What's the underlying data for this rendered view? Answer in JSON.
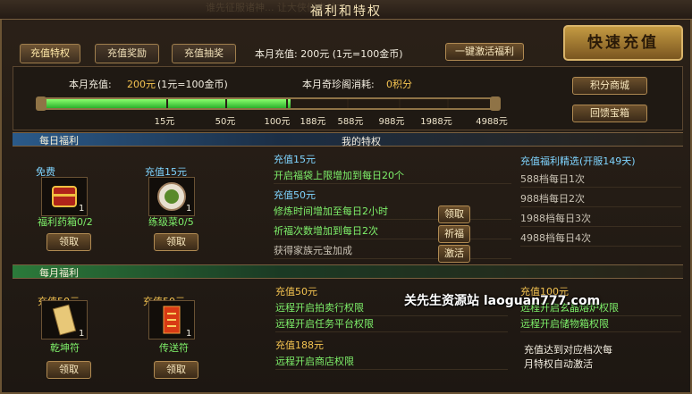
{
  "window": {
    "title": "福利和特权",
    "banner": "谁先征服诸神... 让大侠们去战之!"
  },
  "tabs": [
    {
      "label": "充值特权",
      "active": true
    },
    {
      "label": "充值奖励",
      "active": false
    },
    {
      "label": "充值抽奖",
      "active": false
    }
  ],
  "header": {
    "monthly_recharge": "本月充值: 200元 (1元=100金币)",
    "activate_button": "一键激活福利",
    "quick_recharge": "快速充值"
  },
  "progress": {
    "recharge_label": "本月充值:",
    "recharge_value": "200元",
    "recharge_note": "(1元=100金币)",
    "consume_label": "本月奇珍阁消耗:",
    "consume_value": "0积分",
    "ticks": [
      "15元",
      "50元",
      "100元",
      "188元",
      "588元",
      "988元",
      "1988元",
      "4988元"
    ],
    "filled_fraction": 0.55
  },
  "side_buttons": {
    "shop": "积分商城",
    "treasure": "回馈宝箱"
  },
  "daily": {
    "section_label": "每日福利",
    "privilege_title": "我的特权",
    "items": [
      {
        "tag": "免费",
        "name": "福利药箱0/2",
        "count": "1",
        "claim": "领取",
        "icon": "chest-icon"
      },
      {
        "tag": "充值15元",
        "name": "练级菜0/5",
        "count": "1",
        "claim": "领取",
        "icon": "dish-icon"
      }
    ],
    "perks": [
      {
        "head": "充值15元",
        "text": "开启福袋上限增加到每日20个",
        "button": ""
      },
      {
        "head": "充值50元",
        "text": "修炼时间增加至每日2小时",
        "button": "领取"
      },
      {
        "head": "",
        "text": "祈福次数增加到每日2次",
        "button": "祈福"
      },
      {
        "head": "",
        "text": "获得家族元宝加成",
        "button": "激活"
      }
    ],
    "selected": {
      "title": "充值福利精选(开服149天)",
      "lines": [
        "588档每日1次",
        "988档每日2次",
        "1988档每日3次",
        "4988档每日4次"
      ]
    }
  },
  "monthly": {
    "section_label": "每月福利",
    "items": [
      {
        "tag": "充值50元",
        "name": "乾坤符",
        "count": "1",
        "claim": "领取",
        "icon": "talisman-icon"
      },
      {
        "tag": "充值50元",
        "name": "传送符",
        "count": "1",
        "claim": "领取",
        "icon": "teleport-scroll-icon"
      }
    ],
    "perks_left": [
      {
        "head": "充值50元",
        "lines": [
          "远程开启拍卖行权限",
          "远程开启任务平台权限"
        ]
      },
      {
        "head": "充值188元",
        "lines": [
          "远程开启商店权限"
        ]
      }
    ],
    "perks_right": {
      "head": "充值100元",
      "lines": [
        "远程开启玄晶熔炉权限",
        "远程开启储物箱权限"
      ]
    },
    "note": [
      "充值达到对应档次每",
      "月特权自动激活"
    ]
  },
  "watermark": "关先生资源站 laoguan777.com"
}
